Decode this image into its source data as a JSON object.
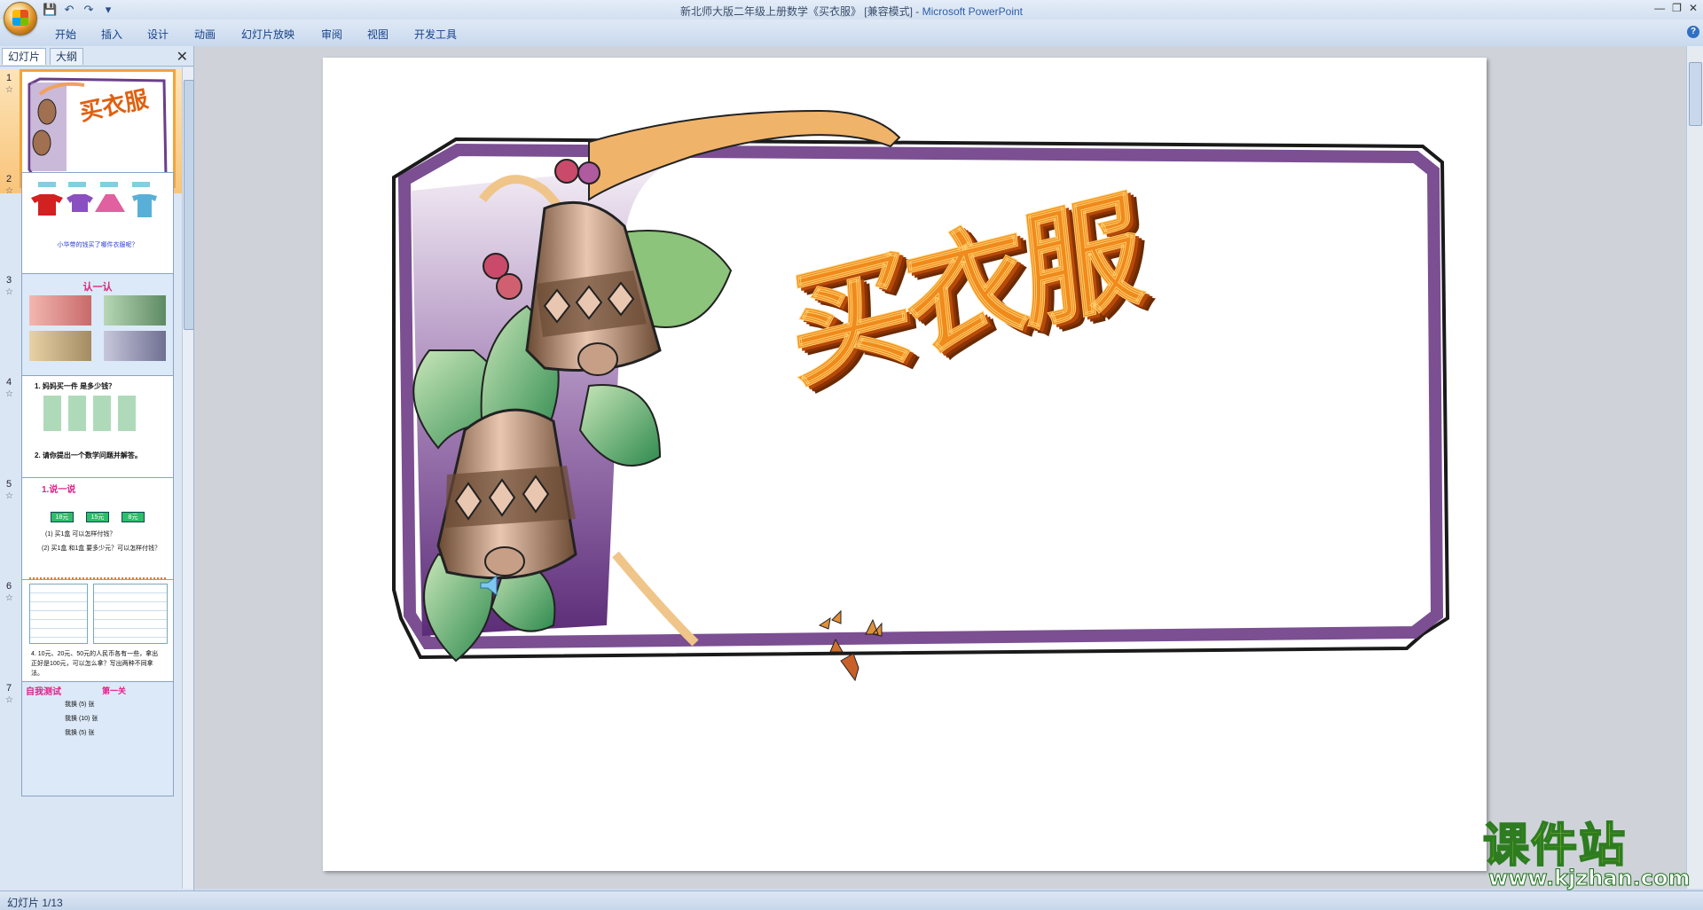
{
  "titlebar": {
    "doc_title": "新北师大版二年级上册数学《买衣服》 [兼容模式] - ",
    "app_name": "Microsoft PowerPoint"
  },
  "ribbon": {
    "tabs": [
      "开始",
      "插入",
      "设计",
      "动画",
      "幻灯片放映",
      "审阅",
      "视图",
      "开发工具"
    ]
  },
  "panel": {
    "tabs": [
      "幻灯片",
      "大纲"
    ]
  },
  "thumbnails": [
    {
      "num": "1",
      "text": "买衣服"
    },
    {
      "num": "2",
      "text": "小华带的钱买了哪件衣服呢？"
    },
    {
      "num": "3",
      "text": "认一认"
    },
    {
      "num": "4",
      "text": "1. 妈妈买一件 是多少钱？",
      "text2": "2. 请你提出一个数学问题并解答。"
    },
    {
      "num": "5",
      "text": "1.说一说",
      "text2": "(1) 买1盒 可以怎样付钱？",
      "text3": "(2) 买1盒 和1盒 要多少元？可以怎样付钱？",
      "prices": [
        "18元",
        "15元",
        "8元"
      ]
    },
    {
      "num": "6",
      "text": "4. 10元、20元、50元的人民币各有一些，拿出正好是100元，可以怎么拿？写出两种不同拿法。"
    },
    {
      "num": "7",
      "text": "自我测试",
      "text2": "第一关",
      "rows": [
        "我换 (5) 张",
        "我换 (10) 张",
        "我换 (5) 张"
      ]
    }
  ],
  "slide": {
    "title": "买衣服"
  },
  "status": {
    "slide_indicator": "幻灯片 1/13"
  },
  "watermark": {
    "cn": "课件站",
    "url": "www.kjzhan.com"
  }
}
